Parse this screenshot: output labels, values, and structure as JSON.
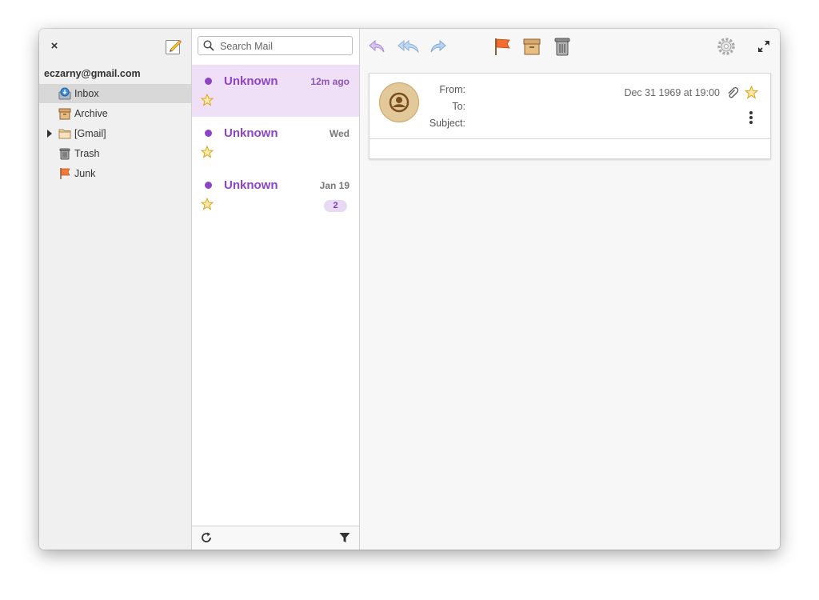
{
  "sidebar": {
    "close_label": "×",
    "account": "eczarny@gmail.com",
    "folders": [
      {
        "label": "Inbox",
        "icon": "inbox-icon",
        "selected": true
      },
      {
        "label": "Archive",
        "icon": "archive-icon"
      },
      {
        "label": "[Gmail]",
        "icon": "folder-icon",
        "expandable": true
      },
      {
        "label": "Trash",
        "icon": "trash-icon"
      },
      {
        "label": "Junk",
        "icon": "junk-flag-icon"
      }
    ]
  },
  "search": {
    "placeholder": "Search Mail"
  },
  "messages": [
    {
      "sender": "Unknown",
      "date": "12m ago",
      "unread": true,
      "selected": true
    },
    {
      "sender": "Unknown",
      "date": "Wed",
      "unread": true
    },
    {
      "sender": "Unknown",
      "date": "Jan 19",
      "unread": true,
      "thread_count": "2"
    }
  ],
  "toolbar": {
    "icons": [
      "reply-icon",
      "reply-all-icon",
      "forward-icon",
      "flag-icon",
      "archive-icon",
      "trash-icon",
      "gear-icon",
      "fullscreen-icon"
    ]
  },
  "header": {
    "from_label": "From:",
    "to_label": "To:",
    "subject_label": "Subject:",
    "date": "Dec 31 1969 at 19:00"
  },
  "colors": {
    "accent": "#8e44c6",
    "selected_bg": "#efe0f7",
    "badge_bg": "#e8d9f4"
  }
}
